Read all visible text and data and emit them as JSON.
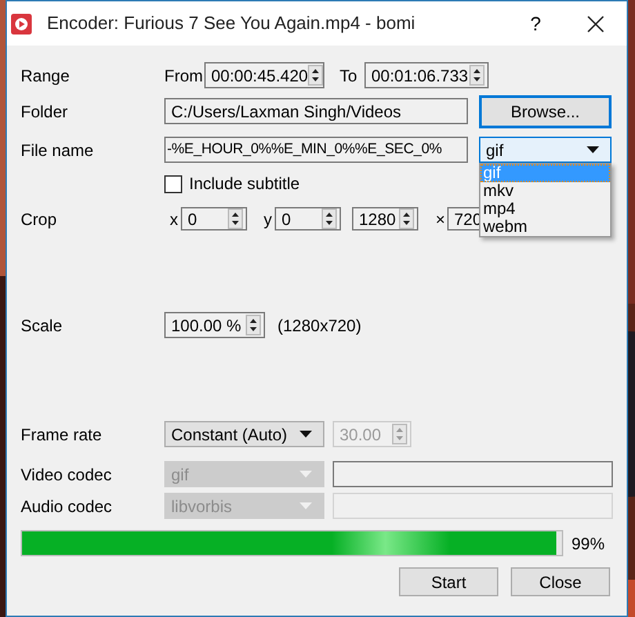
{
  "window": {
    "title": "Encoder: Furious 7 See You Again.mp4 - bomi",
    "help": "?"
  },
  "range": {
    "label": "Range",
    "from_label": "From",
    "from": "00:00:45.420",
    "to_label": "To",
    "to": "00:01:06.733"
  },
  "folder": {
    "label": "Folder",
    "value": "C:/Users/Laxman Singh/Videos",
    "button": "Browse..."
  },
  "file_name": {
    "label": "File name",
    "value": "-%E_HOUR_0%%E_MIN_0%%E_SEC_0%",
    "format": "gif",
    "format_expanded": true,
    "format_options": [
      {
        "label": "gif",
        "selected": true
      },
      {
        "label": "mkv",
        "selected": false
      },
      {
        "label": "mp4",
        "selected": false
      },
      {
        "label": "webm",
        "selected": false
      }
    ]
  },
  "include_subtitle": {
    "label": "Include subtitle",
    "checked": false
  },
  "crop": {
    "label": "Crop",
    "fields": [
      {
        "prefix": "x",
        "value": "0"
      },
      {
        "prefix": "y",
        "value": "0"
      },
      {
        "value": "1280"
      },
      {
        "prefix": "×",
        "value": "720"
      }
    ]
  },
  "scale": {
    "label": "Scale",
    "value": "100.00 %",
    "size": "(1280x720)"
  },
  "frame_rate": {
    "label": "Frame rate",
    "mode": "Constant (Auto)",
    "value": "30.00",
    "value_disabled": true
  },
  "video_codec": {
    "label": "Video codec",
    "value": "gif",
    "disabled": true,
    "options_disabled": false
  },
  "audio_codec": {
    "label": "Audio codec",
    "value": "libvorbis",
    "disabled": true,
    "options_disabled": true
  },
  "progress": {
    "level": 0.99,
    "reading": "99%"
  },
  "buttons": [
    {
      "label": "Start"
    },
    {
      "label": "Close"
    }
  ]
}
